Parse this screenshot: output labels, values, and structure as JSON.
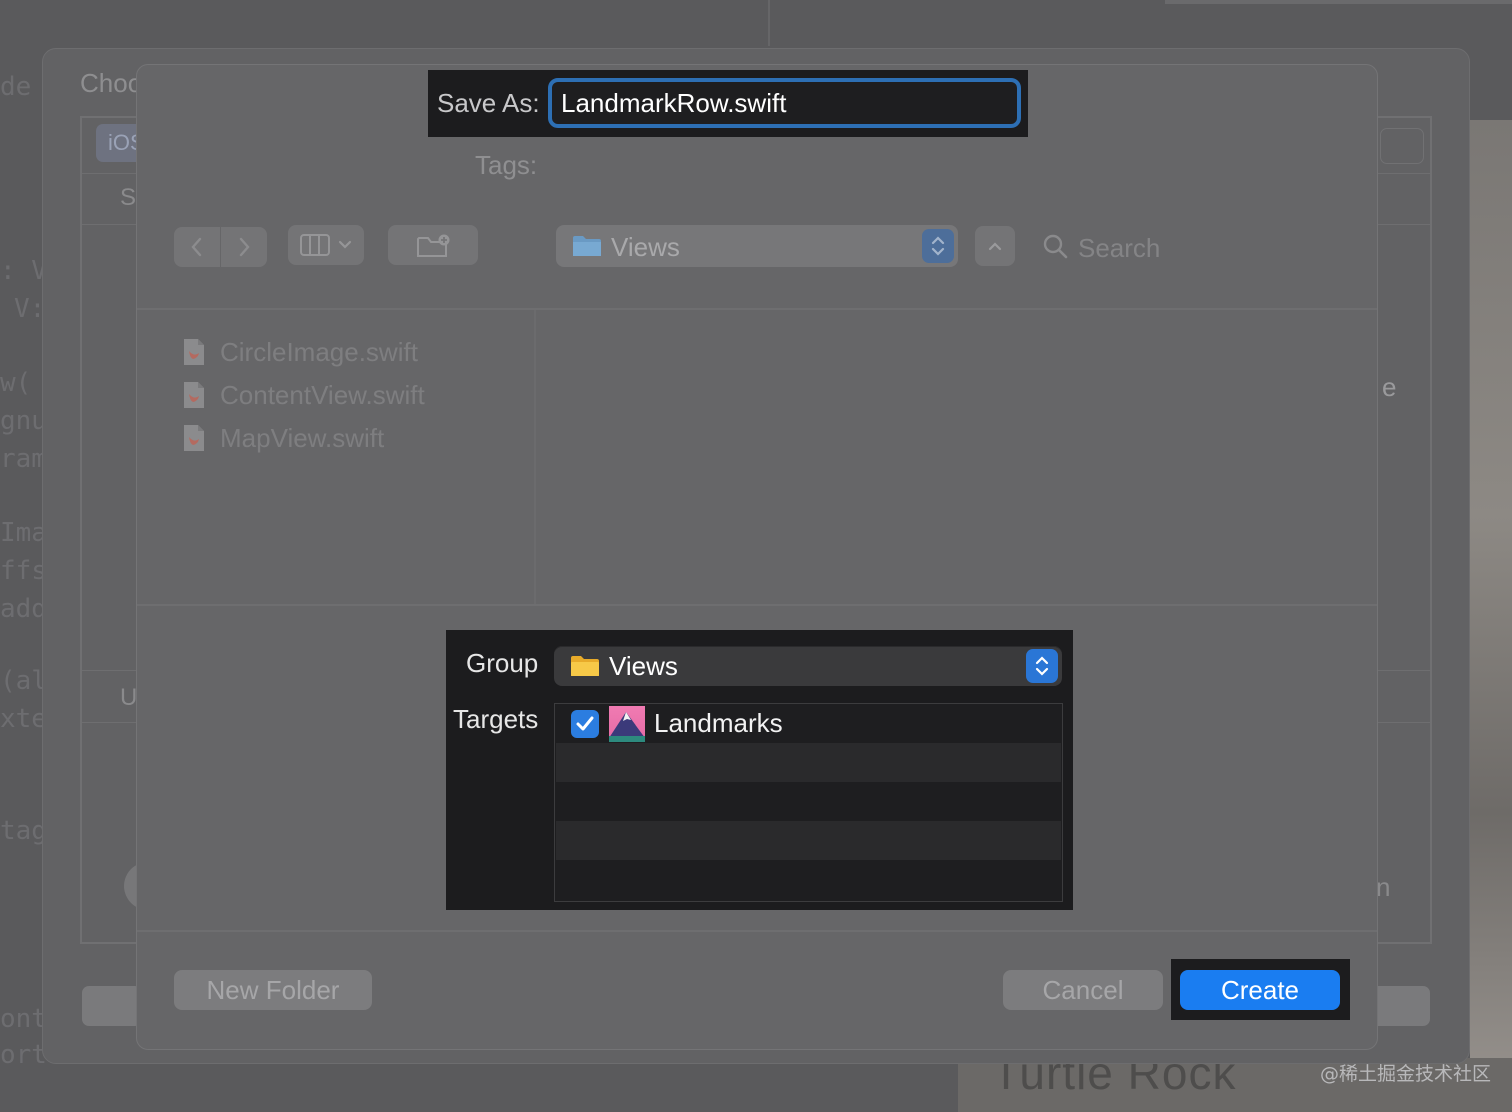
{
  "background": {
    "chooser_title": "Choo",
    "chooser_tab": "iOS",
    "chooser_fragment_s": "S",
    "chooser_fragment_u": "U",
    "chooser_fragment_e": "e",
    "chooser_fragment_n": "n",
    "code_fragments": [
      "de",
      ": V",
      "V:",
      "w(",
      "gnu",
      "ram",
      "Ima",
      "ffs",
      "add",
      "(al",
      "xte",
      "tag",
      "ont",
      "ort"
    ],
    "preview_title": "Turtle Rock"
  },
  "save_sheet": {
    "save_as_label": "Save As:",
    "filename": "LandmarkRow.swift",
    "tags_label": "Tags:",
    "toolbar": {
      "back_icon": "chevron-left-icon",
      "forward_icon": "chevron-right-icon",
      "view_icon": "column-view-icon",
      "new_folder_icon": "new-folder-icon"
    },
    "location": "Views",
    "search_placeholder": "Search",
    "files": [
      "CircleImage.swift",
      "ContentView.swift",
      "MapView.swift"
    ],
    "group_label": "Group",
    "group_value": "Views",
    "targets_label": "Targets",
    "targets": [
      {
        "name": "Landmarks",
        "checked": true
      }
    ],
    "buttons": {
      "new_folder": "New Folder",
      "cancel": "Cancel",
      "create": "Create"
    }
  },
  "watermark": "@稀土掘金技术社区",
  "colors": {
    "accent": "#1a7df1",
    "focus_ring": "#2d6fb4",
    "folder": "#f7c948",
    "swift_file": "#e8573f"
  }
}
